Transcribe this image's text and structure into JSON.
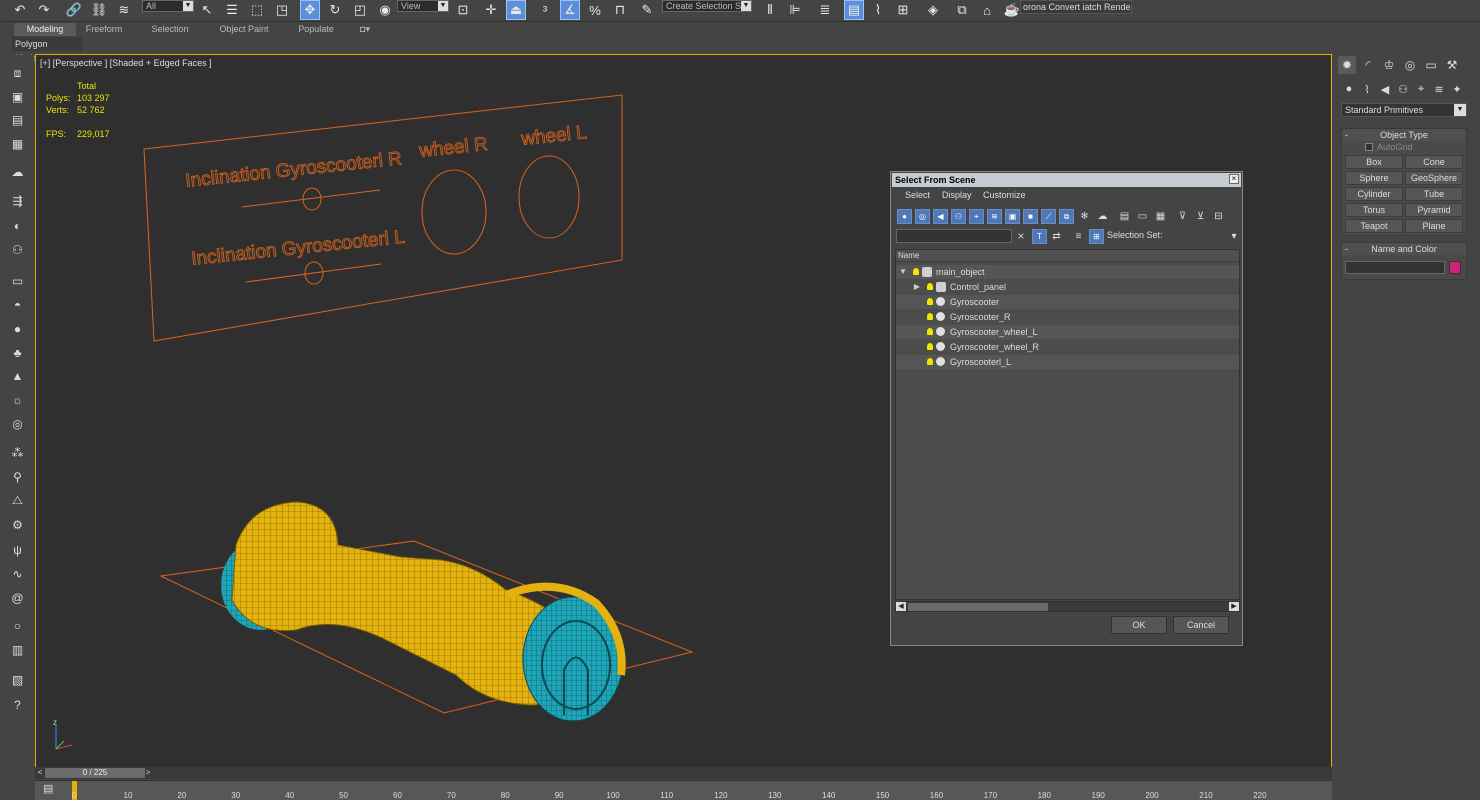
{
  "toolbar": {
    "selection_filter": "All",
    "ref_coord": "View",
    "named_selection": "Create Selection Se",
    "corona_label": "orona Convert iatch Render..."
  },
  "ribbon": {
    "tabs": [
      "Modeling",
      "Freeform",
      "Selection",
      "Object Paint",
      "Populate"
    ],
    "active_tab": "Modeling",
    "subtab": "Polygon Modeling"
  },
  "viewport": {
    "label": "[+] [Perspective ] [Shaded + Edged Faces ]",
    "stats": {
      "total_label": "Total",
      "polys_label": "Polys:",
      "polys_value": "103 297",
      "verts_label": "Verts:",
      "verts_value": "52 762",
      "fps_label": "FPS:",
      "fps_value": "229,017"
    },
    "control_panel_texts": [
      "Inclination Gyroscooterl R",
      "Inclination Gyroscooterl L",
      "wheel R",
      "wheel L"
    ],
    "colors": {
      "wire_yellow": "#e3b20f",
      "wire_teal": "#1da6b8",
      "panel_orange": "#d9641c",
      "border": "#e3b100"
    }
  },
  "command_panel": {
    "dropdown": "Standard Primitives",
    "object_type_header": "Object Type",
    "autogrid": "AutoGrid",
    "primitives": [
      "Box",
      "Cone",
      "Sphere",
      "GeoSphere",
      "Cylinder",
      "Tube",
      "Torus",
      "Pyramid",
      "Teapot",
      "Plane"
    ],
    "name_color_header": "Name and Color",
    "swatch_color": "#d0207a"
  },
  "dialog": {
    "title": "Select From Scene",
    "close": "×",
    "menu": [
      "Select",
      "Display",
      "Customize"
    ],
    "selection_set_label": "Selection Set:",
    "column_header": "Name",
    "tree": [
      {
        "label": "main_object",
        "level": 0,
        "expanded": true,
        "group": true
      },
      {
        "label": "Control_panel",
        "level": 1,
        "expanded": false,
        "group": true
      },
      {
        "label": "Gyroscooter",
        "level": 1,
        "group": false
      },
      {
        "label": "Gyroscooter_R",
        "level": 1,
        "group": false
      },
      {
        "label": "Gyroscooter_wheel_L",
        "level": 1,
        "group": false
      },
      {
        "label": "Gyroscooter_wheel_R",
        "level": 1,
        "group": false
      },
      {
        "label": "Gyroscooterl_L",
        "level": 1,
        "group": false
      }
    ],
    "ok_label": "OK",
    "cancel_label": "Cancel"
  },
  "timeline": {
    "frame_counter": "0 / 225",
    "ticks": [
      "0",
      "10",
      "20",
      "30",
      "40",
      "50",
      "60",
      "70",
      "80",
      "90",
      "100",
      "110",
      "120",
      "130",
      "140",
      "150",
      "160",
      "170",
      "180",
      "190",
      "200",
      "210",
      "220"
    ]
  }
}
